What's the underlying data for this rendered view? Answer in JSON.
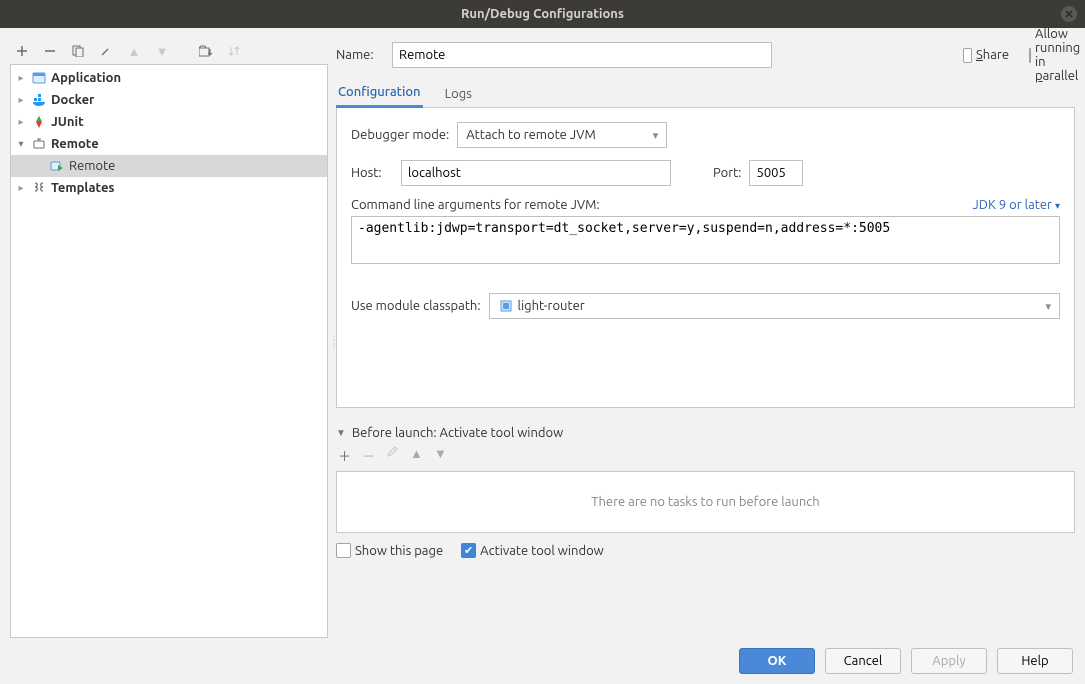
{
  "window": {
    "title": "Run/Debug Configurations"
  },
  "tree": {
    "items": [
      {
        "label": "Application",
        "icon": "application"
      },
      {
        "label": "Docker",
        "icon": "docker"
      },
      {
        "label": "JUnit",
        "icon": "junit"
      },
      {
        "label": "Remote",
        "icon": "remote",
        "expanded": true,
        "children": [
          {
            "label": "Remote",
            "icon": "remote-run",
            "selected": true
          }
        ]
      },
      {
        "label": "Templates",
        "icon": "templates"
      }
    ]
  },
  "form": {
    "name_label": "Name:",
    "name_value": "Remote",
    "share_label": "Share",
    "parallel_label": "Allow running in parallel",
    "share_checked": false,
    "parallel_checked": false
  },
  "tabs": {
    "configuration": "Configuration",
    "logs": "Logs",
    "active": "configuration"
  },
  "config": {
    "debugger_mode_label": "Debugger mode:",
    "debugger_mode_value": "Attach to remote JVM",
    "host_label": "Host:",
    "host_value": "localhost",
    "port_label": "Port:",
    "port_value": "5005",
    "cmd_label": "Command line arguments for remote JVM:",
    "jdk_label": "JDK 9 or later",
    "cmd_value": "-agentlib:jdwp=transport=dt_socket,server=y,suspend=n,address=*:5005",
    "module_label": "Use module classpath:",
    "module_value": "light-router"
  },
  "before_launch": {
    "header": "Before launch: Activate tool window",
    "empty_text": "There are no tasks to run before launch",
    "show_this_page": "Show this page",
    "show_this_page_checked": false,
    "activate_tool": "Activate tool window",
    "activate_tool_checked": true
  },
  "buttons": {
    "ok": "OK",
    "cancel": "Cancel",
    "apply": "Apply",
    "help": "Help"
  }
}
